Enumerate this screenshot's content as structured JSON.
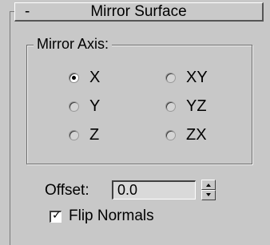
{
  "rollout": {
    "collapse_symbol": "-",
    "title": "Mirror Surface"
  },
  "mirror_axis": {
    "label": "Mirror Axis:",
    "selected": "X",
    "options": [
      {
        "label": "X",
        "checked": true
      },
      {
        "label": "XY",
        "checked": false
      },
      {
        "label": "Y",
        "checked": false
      },
      {
        "label": "YZ",
        "checked": false
      },
      {
        "label": "Z",
        "checked": false
      },
      {
        "label": "ZX",
        "checked": false
      }
    ]
  },
  "offset": {
    "label": "Offset:",
    "value": "0.0"
  },
  "flip_normals": {
    "label": "Flip Normals",
    "checked": true,
    "check_glyph": "✓"
  },
  "colors": {
    "panel_bg": "#c8c8c8",
    "input_bg": "#d9d9d9"
  }
}
